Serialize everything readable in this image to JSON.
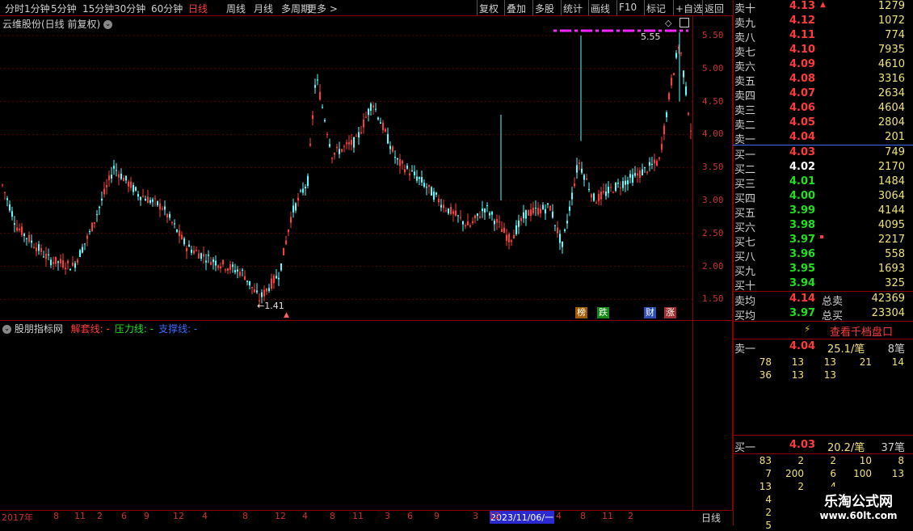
{
  "toolbar": {
    "left_items": [
      "分时",
      "1分钟",
      "5分钟",
      "15分钟",
      "30分钟",
      "60分钟",
      "日线",
      "周线",
      "月线",
      "多周期",
      "更多 >"
    ],
    "active_index": 6,
    "right_items": [
      "复权",
      "叠加",
      "多股",
      "统计",
      "画线",
      "F10",
      "标记",
      "+自选",
      "返回"
    ]
  },
  "main_chart": {
    "title": "云维股份(日线 前复权)",
    "y_ticks": [
      "5.50",
      "5.00",
      "4.50",
      "4.00",
      "3.50",
      "3.00",
      "2.50",
      "2.00",
      "1.50"
    ],
    "high_label": "5.55",
    "low_label": "1.41",
    "tags": [
      "榜",
      "跌",
      "财",
      "涨"
    ]
  },
  "indicator": {
    "title": "股朋指标网",
    "lines": [
      {
        "label": "解套线: -",
        "color": "#ff3b3b"
      },
      {
        "label": "压力线: -",
        "color": "#20e020"
      },
      {
        "label": "支撑线: -",
        "color": "#3a6bff"
      }
    ]
  },
  "x_axis": {
    "labels": [
      "2017年",
      "8",
      "11",
      "2",
      "6",
      "9",
      "12",
      "4",
      "8",
      "12",
      "4",
      "8",
      "11",
      "3",
      "6",
      "9",
      "2023/11/06/一",
      "3",
      "12",
      "4",
      "8",
      "11",
      "2"
    ],
    "period_label": "日线"
  },
  "orderbook": {
    "asks": [
      {
        "label": "卖十",
        "price": "4.13",
        "vol": "1279"
      },
      {
        "label": "卖九",
        "price": "4.12",
        "vol": "1072"
      },
      {
        "label": "卖八",
        "price": "4.11",
        "vol": "774"
      },
      {
        "label": "卖七",
        "price": "4.10",
        "vol": "7935"
      },
      {
        "label": "卖六",
        "price": "4.09",
        "vol": "4610"
      },
      {
        "label": "卖五",
        "price": "4.08",
        "vol": "3316"
      },
      {
        "label": "卖四",
        "price": "4.07",
        "vol": "2634"
      },
      {
        "label": "卖三",
        "price": "4.06",
        "vol": "4604"
      },
      {
        "label": "卖二",
        "price": "4.05",
        "vol": "2804"
      },
      {
        "label": "卖一",
        "price": "4.04",
        "vol": "201"
      }
    ],
    "bids": [
      {
        "label": "买一",
        "price": "4.03",
        "vol": "749"
      },
      {
        "label": "买二",
        "price": "4.02",
        "vol": "2170"
      },
      {
        "label": "买三",
        "price": "4.01",
        "vol": "1484"
      },
      {
        "label": "买四",
        "price": "4.00",
        "vol": "3064"
      },
      {
        "label": "买五",
        "price": "3.99",
        "vol": "4144"
      },
      {
        "label": "买六",
        "price": "3.98",
        "vol": "4095"
      },
      {
        "label": "买七",
        "price": "3.97",
        "vol": "2217"
      },
      {
        "label": "买八",
        "price": "3.96",
        "vol": "558"
      },
      {
        "label": "买九",
        "price": "3.95",
        "vol": "1693"
      },
      {
        "label": "买十",
        "price": "3.94",
        "vol": "325"
      }
    ],
    "avg_sell_label": "卖均",
    "avg_sell_price": "4.14",
    "total_sell_label": "总卖",
    "total_sell": "42369",
    "avg_buy_label": "买均",
    "avg_buy_price": "3.97",
    "total_buy_label": "总买",
    "total_buy": "23304",
    "thousand_button": "查看千档盘口",
    "queue_sell": {
      "label": "卖一",
      "price": "4.04",
      "avg": "25.1/笔",
      "count": "8笔",
      "rows": [
        [
          "78",
          "13",
          "13",
          "21",
          "14"
        ],
        [
          "36",
          "13",
          "13",
          "",
          ""
        ]
      ]
    },
    "queue_buy": {
      "label": "买一",
      "price": "4.03",
      "avg": "20.2/笔",
      "count": "37笔",
      "rows": [
        [
          "83",
          "2",
          "2",
          "10",
          "8"
        ],
        [
          "7",
          "200",
          "6",
          "100",
          "13"
        ],
        [
          "13",
          "2",
          "4",
          "",
          ""
        ],
        [
          "4",
          "",
          "",
          "",
          ""
        ],
        [
          "2",
          "",
          "",
          "",
          ""
        ],
        [
          "5",
          "",
          "",
          "",
          ""
        ]
      ]
    }
  },
  "watermark": {
    "name": "乐淘公式网",
    "url": "www.60lt.com"
  }
}
